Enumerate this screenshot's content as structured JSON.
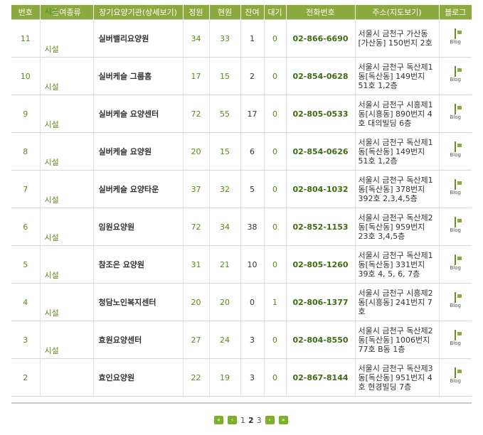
{
  "headers": [
    "번호",
    "급여종류",
    "장기요양기관(상세보기)",
    "정원",
    "현원",
    "잔여",
    "대기",
    "전화번호",
    "주소(지도보기)",
    "블로그"
  ],
  "rows": [
    {
      "no": "11",
      "type": "시설",
      "name": "실버밸리요양원",
      "cap": "34",
      "cur": "33",
      "rem": "1",
      "wait": "0",
      "phone": "02-866-6690",
      "addr": "서울시 금천구 가산동[가산동] 150번지 2호",
      "blog": "Blog"
    },
    {
      "no": "10",
      "type": "시설",
      "name": "실버케슬 그룹홈",
      "cap": "17",
      "cur": "15",
      "rem": "2",
      "wait": "0",
      "phone": "02-854-0628",
      "addr": "서울시 금천구 독산제1동[독산동] 149번지 51호 1,2층",
      "blog": "Blog"
    },
    {
      "no": "9",
      "type": "시설",
      "name": "실버케슬 요양센터",
      "cap": "72",
      "cur": "55",
      "rem": "17",
      "wait": "0",
      "phone": "02-805-0533",
      "addr": "서울시 금천구 시흥제1동[시흥동] 890번지 4호 대의빌딩 6층",
      "blog": "Blog"
    },
    {
      "no": "8",
      "type": "시설",
      "name": "실버케슬 요양원",
      "cap": "20",
      "cur": "15",
      "rem": "6",
      "wait": "0",
      "phone": "02-854-0626",
      "addr": "서울시 금천구 독산제1동[독산동] 149번지 51호 1,2층",
      "blog": "Blog"
    },
    {
      "no": "7",
      "type": "시설",
      "name": "실버케슬 요양타운",
      "cap": "37",
      "cur": "32",
      "rem": "5",
      "wait": "0",
      "phone": "02-804-1032",
      "addr": "서울시 금천구 독산제1동[독산동] 378번지 392호 2,3,4,5층",
      "blog": "Blog"
    },
    {
      "no": "6",
      "type": "시설",
      "name": "임원요양원",
      "cap": "72",
      "cur": "34",
      "rem": "38",
      "wait": "0",
      "phone": "02-852-1153",
      "addr": "서울시 금천구 독산제2동[독산동] 959번지 23호 3,4,5층",
      "blog": "Blog"
    },
    {
      "no": "5",
      "type": "시설",
      "name": "참조은 요양원",
      "cap": "31",
      "cur": "21",
      "rem": "10",
      "wait": "0",
      "phone": "02-805-1260",
      "addr": "서울시 금천구 독산제1동[독산동] 331번지 39호 4, 5, 6, 7층",
      "blog": "Blog"
    },
    {
      "no": "4",
      "type": "시설",
      "name": "청담노인복지센터",
      "cap": "20",
      "cur": "20",
      "rem": "0",
      "wait": "1",
      "phone": "02-806-1377",
      "addr": "서울시 금천구 시흥제2동[시흥동] 241번지 7호",
      "blog": "Blog"
    },
    {
      "no": "3",
      "type": "시설",
      "name": "효원요양센터",
      "cap": "27",
      "cur": "24",
      "rem": "3",
      "wait": "0",
      "phone": "02-804-8550",
      "addr": "서울시 금천구 독산제2동[독산동] 1006번지 77호 B동 1층",
      "blog": "Blog"
    },
    {
      "no": "2",
      "type": "시설",
      "name": "효인요양원",
      "cap": "22",
      "cur": "19",
      "rem": "3",
      "wait": "0",
      "phone": "02-867-8144",
      "addr": "서울시 금천구 독산제3동[독산동] 951번지 4호 현경빌딩 7층",
      "blog": "Blog"
    }
  ],
  "pager": {
    "first": "«",
    "prev": "‹",
    "pages": [
      "1",
      "2",
      "3"
    ],
    "current": "2",
    "next": "›",
    "last": "»"
  },
  "colors": {
    "header_bg": "#8aaa3e",
    "accent": "#5a8a1a",
    "pager_btn": "#7cb02a"
  }
}
